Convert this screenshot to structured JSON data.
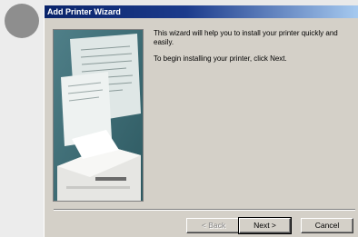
{
  "window": {
    "title": "Add Printer Wizard"
  },
  "intro": {
    "line1": "This wizard will help you to install your printer quickly and easily.",
    "line2": "To begin installing your printer, click Next."
  },
  "buttons": {
    "back": "< Back",
    "next": "Next >",
    "cancel": "Cancel"
  },
  "colors": {
    "titlebar": "#0a246a",
    "dialog": "#d4d0c8"
  },
  "icons": {
    "avatar": "user-avatar-circle",
    "wizard_image": "printer-illustration"
  }
}
